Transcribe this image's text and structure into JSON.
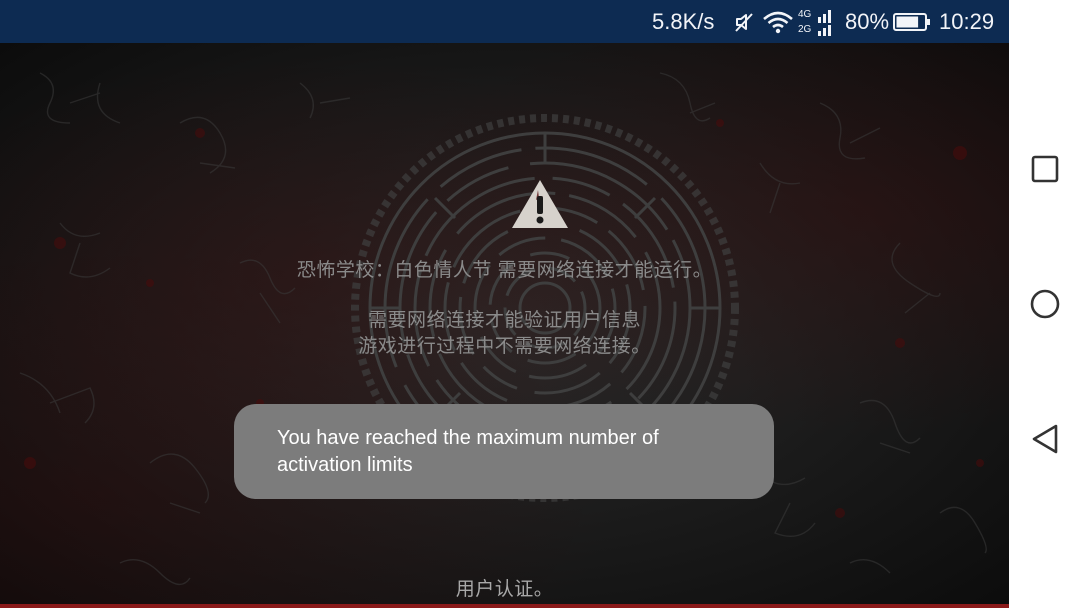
{
  "status_bar": {
    "network_speed": "5.8K/s",
    "network_types": [
      "4G",
      "2G"
    ],
    "battery_percent": "80%",
    "battery_level": 0.8,
    "time": "10:29",
    "background_color": "#0d2b52",
    "icons": [
      "mute-icon",
      "wifi-icon",
      "signal-icon",
      "battery-icon"
    ]
  },
  "game": {
    "message_title": "恐怖学校：白色情人节 需要网络连接才能运行。",
    "message_line1": "需要网络连接才能验证用户信息",
    "message_line2": "游戏进行过程中不需要网络连接。",
    "footer_label": "用户认证。",
    "icons": [
      "warning-icon",
      "maze-emblem"
    ]
  },
  "toast": {
    "text": "You have reached the maximum number of activation limits"
  },
  "nav_bar": {
    "buttons": [
      "recents",
      "home",
      "back"
    ],
    "icons": [
      "square-icon",
      "circle-icon",
      "triangle-back-icon"
    ]
  }
}
